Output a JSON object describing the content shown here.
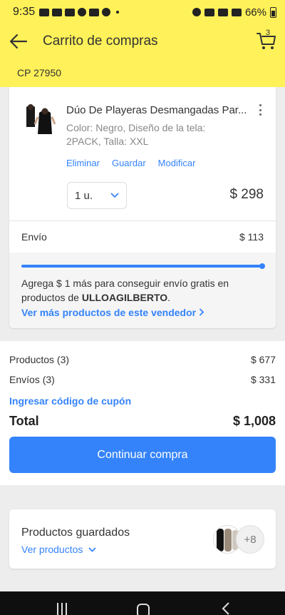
{
  "status_bar": {
    "time": "9:35",
    "battery": "66%"
  },
  "header": {
    "title": "Carrito de compras",
    "cart_count": "3",
    "postal_code": "CP 27950"
  },
  "item": {
    "title": "Dúo De Playeras Desmangadas Par...",
    "desc_line1": "Color: Negro, Diseño de la tela:",
    "desc_line2": "2PACK, Talla: XXL",
    "actions": {
      "remove": "Eliminar",
      "save": "Guardar",
      "modify": "Modificar"
    },
    "quantity": "1 u.",
    "price": "$ 298",
    "shipping_label": "Envío",
    "shipping_value": "$ 113",
    "free_shipping_progress": 1.0,
    "free_shipping_text_prefix": "Agrega $ 1 más para conseguir envío gratis en productos de ",
    "seller": "ULLOAGILBERTO",
    "free_shipping_text_suffix": ".",
    "more_products_link": "Ver más productos de este vendedor"
  },
  "summary": {
    "products_label": "Productos (3)",
    "products_value": "$ 677",
    "shipping_label": "Envíos (3)",
    "shipping_value": "$ 331",
    "coupon_link": "Ingresar código de cupón",
    "total_label": "Total",
    "total_value": "$ 1,008",
    "continue_button": "Continuar compra"
  },
  "saved": {
    "title": "Productos guardados",
    "link": "Ver productos",
    "more_count": "+8"
  },
  "colors": {
    "brand_yellow": "#fff159",
    "link_blue": "#3483fa",
    "button_blue": "#3483fa"
  }
}
